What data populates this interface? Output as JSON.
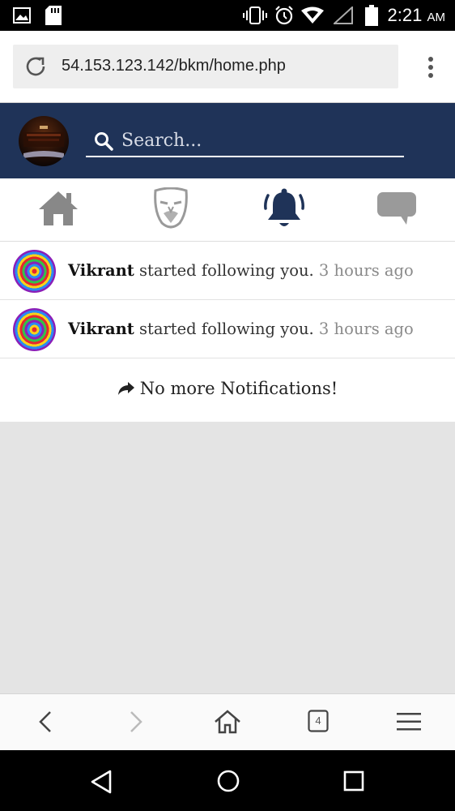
{
  "status_bar": {
    "time": "2:21",
    "ampm": "AM",
    "icons": [
      "image-icon",
      "sd-card-icon",
      "vibrate-icon",
      "alarm-icon",
      "wifi-icon",
      "signal-icon",
      "battery-icon"
    ]
  },
  "browser": {
    "url": "54.153.123.142/bkm/home.php",
    "tab_count": "4",
    "icons": [
      "reload-icon",
      "more-vert-icon",
      "back-icon",
      "forward-icon",
      "home-icon",
      "tabs-icon",
      "menu-icon"
    ]
  },
  "header": {
    "background": "#1f3358",
    "search_placeholder": "Search..."
  },
  "tabs": [
    {
      "name": "home",
      "icon": "home-icon",
      "active": false
    },
    {
      "name": "anonymous",
      "icon": "mask-icon",
      "active": false
    },
    {
      "name": "notifications",
      "icon": "bell-icon",
      "active": true
    },
    {
      "name": "messages",
      "icon": "chat-bubble-icon",
      "active": false
    }
  ],
  "notifications": [
    {
      "name": "Vikrant",
      "action": "started following you.",
      "time": "3 hours ago"
    },
    {
      "name": "Vikrant",
      "action": "started following you.",
      "time": "3 hours ago"
    }
  ],
  "footer": {
    "no_more": "No more Notifications!"
  }
}
